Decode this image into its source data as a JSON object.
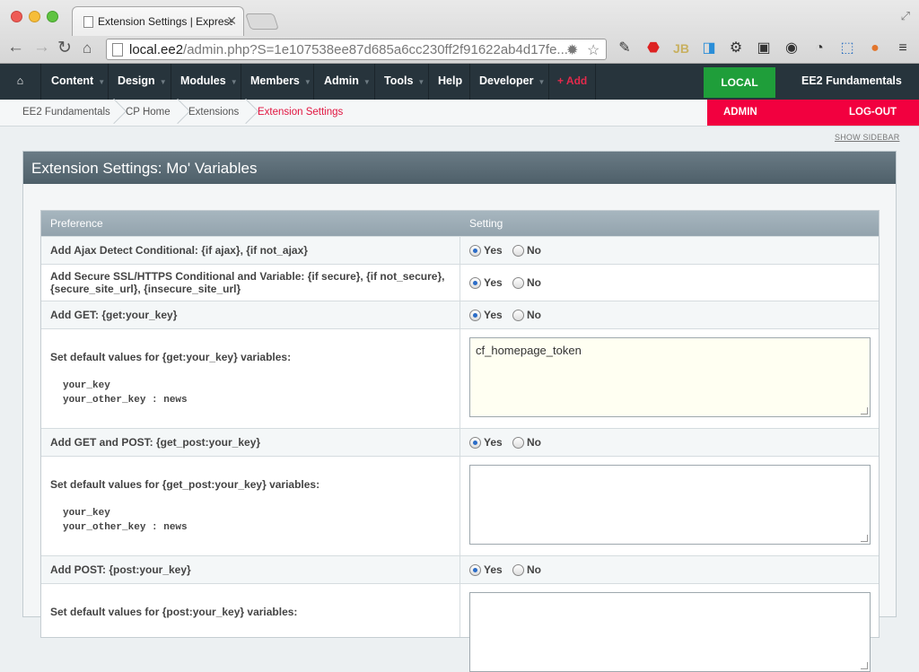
{
  "browser": {
    "tab_title": "Extension Settings | ExpressionEngine",
    "url_host": "local.ee2",
    "url_path": "/admin.php?S=1e107538ee87d685a6cc230ff2f91622ab4d17fe..."
  },
  "nav": {
    "items": [
      "Content",
      "Design",
      "Modules",
      "Members",
      "Admin",
      "Tools",
      "Help",
      "Developer"
    ],
    "add_label": "+ Add",
    "env_label": "LOCAL",
    "site_name": "EE2 Fundamentals"
  },
  "breadcrumbs": {
    "items": [
      "EE2 Fundamentals",
      "CP Home",
      "Extensions"
    ],
    "current": "Extension Settings",
    "admin_label": "ADMIN",
    "logout_label": "LOG-OUT"
  },
  "show_sidebar": "SHOW SIDEBAR",
  "panel": {
    "title": "Extension Settings: Mo' Variables"
  },
  "table": {
    "headers": [
      "Preference",
      "Setting"
    ],
    "rows": [
      {
        "label": "Add Ajax Detect Conditional: {if ajax}, {if not_ajax}",
        "yes": "Yes",
        "no": "No"
      },
      {
        "label_line1": "Add Secure SSL/HTTPS Conditional and Variable: {if secure}, {if not_secure},",
        "label_line2": "{secure_site_url}, {insecure_site_url}",
        "yes": "Yes",
        "no": "No"
      },
      {
        "label": "Add GET: {get:your_key}",
        "yes": "Yes",
        "no": "No"
      },
      {
        "label": "Set default values for {get:your_key} variables:",
        "code1": "your_key",
        "code2": "your_other_key : news",
        "value": "cf_homepage_token"
      },
      {
        "label": "Add GET and POST: {get_post:your_key}",
        "yes": "Yes",
        "no": "No"
      },
      {
        "label": "Set default values for {get_post:your_key} variables:",
        "code1": "your_key",
        "code2": "your_other_key : news",
        "value": ""
      },
      {
        "label": "Add POST: {post:your_key}",
        "yes": "Yes",
        "no": "No"
      },
      {
        "label": "Set default values for {post:your_key} variables:"
      }
    ]
  }
}
